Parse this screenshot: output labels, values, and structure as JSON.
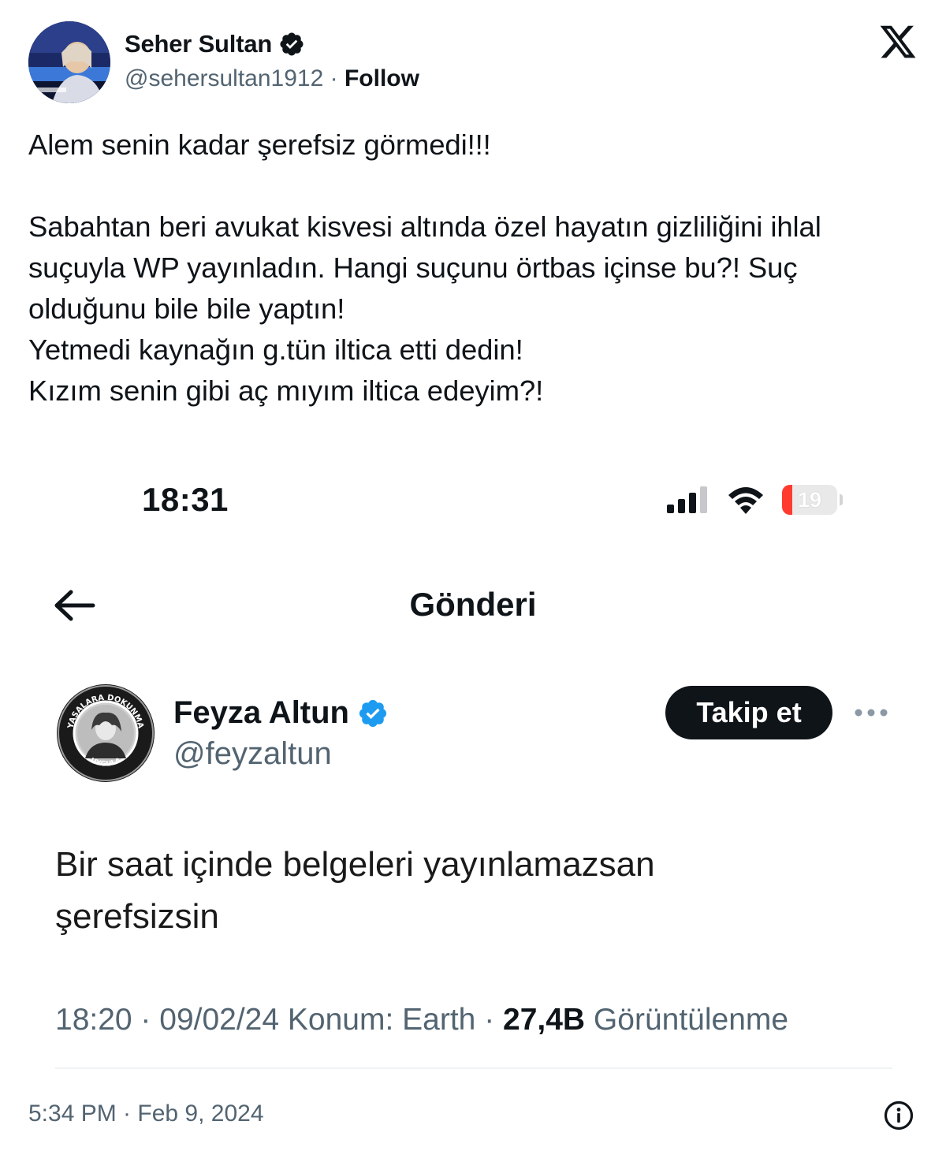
{
  "tweet": {
    "author": {
      "name": "Seher Sultan",
      "handle": "@sehersultan1912",
      "separator": " · ",
      "follow_label": "Follow",
      "verified": true
    },
    "brand_icon": "x-logo-icon",
    "text": "Alem senin kadar şerefsiz görmedi!!!\n\nSabahtan beri avukat kisvesi altında özel hayatın gizliliğini ihlal suçuyla WP yayınladın. Hangi suçunu örtbas içinse bu?! Suç olduğunu bile bile yaptın!\nYetmedi kaynağın g.tün iltica etti dedin!\nKızım senin gibi aç mıyım iltica edeyim?!",
    "timestamp": "5:34 PM · Feb 9, 2024",
    "info_icon": "info-icon"
  },
  "embedded_screenshot": {
    "status_bar": {
      "time": "18:31",
      "battery_level": "19",
      "battery_fill_percent": 19,
      "icons": [
        "signal-icon",
        "wifi-icon",
        "battery-icon"
      ]
    },
    "header": {
      "title": "Gönderi",
      "back_icon": "back-arrow-icon"
    },
    "post": {
      "author_name": "Feyza Altun",
      "author_handle": "@feyzaltun",
      "verified": true,
      "follow_label": "Takip et",
      "more_icon": "more-dots-icon",
      "avatar_ring_text_top": "YASALARA DOKUNMA",
      "avatar_ring_text_bottom": "UYGULA",
      "text": "Bir saat içinde belgeleri yayınlamazsan\nşerefsizsin",
      "meta": {
        "time_date_location": "18:20 · 09/02/24 Konum: Earth · ",
        "views_count": "27,4B",
        "views_label": " Görüntülenme"
      }
    }
  },
  "colors": {
    "text_primary": "#0f1419",
    "text_secondary": "#536471",
    "verified_blue": "#1d9bf0",
    "button_dark": "#0f1419",
    "battery_red": "#ff3b30"
  }
}
